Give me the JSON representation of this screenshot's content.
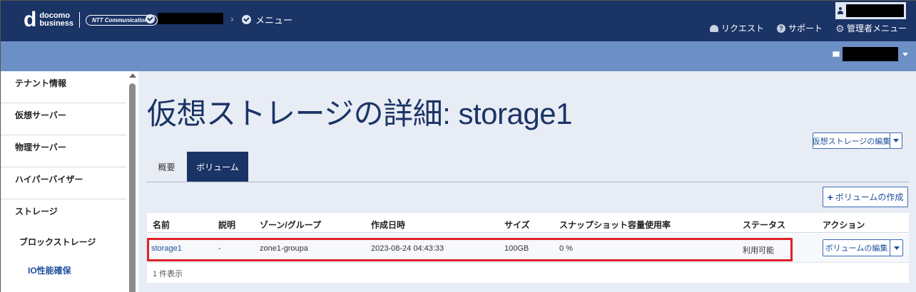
{
  "header": {
    "brand_line1": "docomo",
    "brand_line2": "business",
    "partner_logo": "NTT Communications",
    "breadcrumb_menu": "メニュー",
    "links": [
      {
        "label": "リクエスト",
        "icon": "bell-icon"
      },
      {
        "label": "サポート",
        "icon": "help-icon"
      },
      {
        "label": "管理者メニュー",
        "icon": "gear-icon"
      }
    ]
  },
  "sidebar": {
    "items": [
      {
        "label": "テナント情報"
      },
      {
        "label": "仮想サーバー"
      },
      {
        "label": "物理サーバー"
      },
      {
        "label": "ハイパーバイザー"
      },
      {
        "label": "ストレージ"
      }
    ],
    "sub_item": "ブロックストレージ",
    "sub_sub_item": "IO性能確保"
  },
  "main": {
    "title": "仮想ストレージの詳細: storage1",
    "edit_button": "仮想ストレージの編集",
    "tabs": [
      {
        "label": "概要",
        "active": false
      },
      {
        "label": "ボリューム",
        "active": true
      }
    ],
    "create_button": "ボリュームの作成",
    "table": {
      "headers": [
        "名前",
        "説明",
        "ゾーン/グループ",
        "作成日時",
        "サイズ",
        "スナップショット容量使用率",
        "ステータス",
        "アクション"
      ],
      "rows": [
        {
          "name": "storage1",
          "description": "-",
          "zone": "zone1-groupa",
          "created": "2023-08-24 04:43:33",
          "size": "100GB",
          "snapshot_usage": "0 %",
          "status": "利用可能",
          "action": "ボリュームの編集"
        }
      ],
      "footer": "1 件表示"
    }
  },
  "colors": {
    "header_bg": "#1b3466",
    "subbar_bg": "#6c8fc6",
    "main_bg": "#e8ecf4",
    "accent": "#1e4f9c",
    "highlight": "#e0202a"
  }
}
